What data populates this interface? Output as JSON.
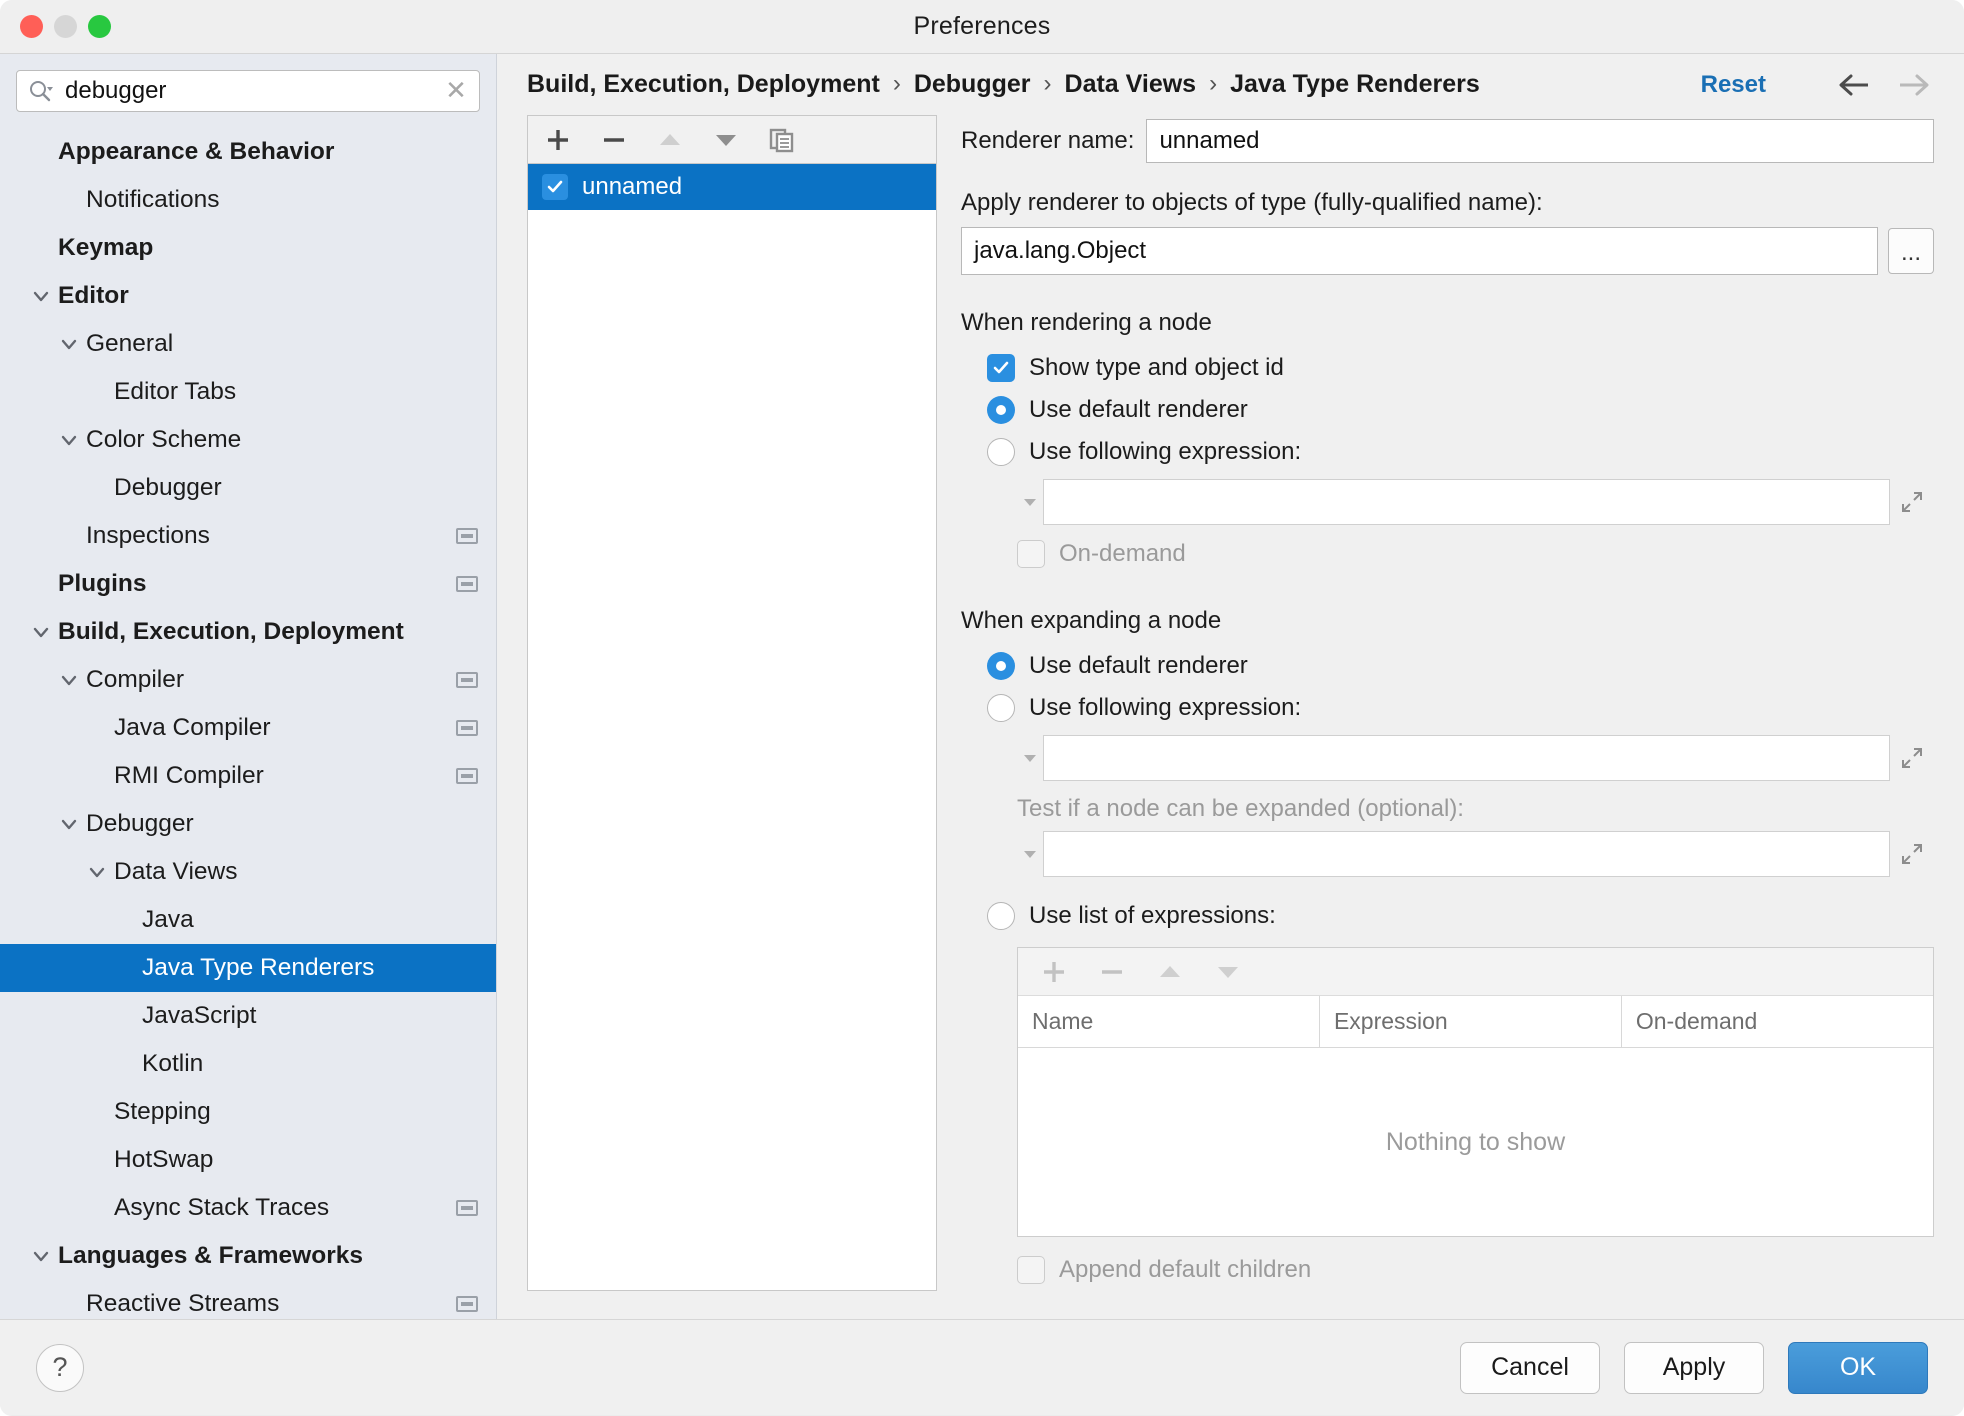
{
  "window": {
    "title": "Preferences",
    "traffic_lights": [
      "close",
      "minimize",
      "zoom"
    ]
  },
  "search": {
    "value": "debugger",
    "placeholder": "",
    "icon": "search-icon",
    "clear_icon": "close-icon"
  },
  "sidebar": {
    "items": [
      {
        "label": "Appearance & Behavior",
        "indent": 0,
        "bold": true,
        "twisty": "",
        "badge": false,
        "selected": false
      },
      {
        "label": "Notifications",
        "indent": 1,
        "bold": false,
        "twisty": "",
        "badge": false,
        "selected": false
      },
      {
        "label": "Keymap",
        "indent": 0,
        "bold": true,
        "twisty": "",
        "badge": false,
        "selected": false
      },
      {
        "label": "Editor",
        "indent": 0,
        "bold": true,
        "twisty": "down",
        "badge": false,
        "selected": false
      },
      {
        "label": "General",
        "indent": 1,
        "bold": false,
        "twisty": "down",
        "badge": false,
        "selected": false
      },
      {
        "label": "Editor Tabs",
        "indent": 2,
        "bold": false,
        "twisty": "",
        "badge": false,
        "selected": false
      },
      {
        "label": "Color Scheme",
        "indent": 1,
        "bold": false,
        "twisty": "down",
        "badge": false,
        "selected": false
      },
      {
        "label": "Debugger",
        "indent": 2,
        "bold": false,
        "twisty": "",
        "badge": false,
        "selected": false
      },
      {
        "label": "Inspections",
        "indent": 1,
        "bold": false,
        "twisty": "",
        "badge": true,
        "selected": false
      },
      {
        "label": "Plugins",
        "indent": 0,
        "bold": true,
        "twisty": "",
        "badge": true,
        "selected": false
      },
      {
        "label": "Build, Execution, Deployment",
        "indent": 0,
        "bold": true,
        "twisty": "down",
        "badge": false,
        "selected": false
      },
      {
        "label": "Compiler",
        "indent": 1,
        "bold": false,
        "twisty": "down",
        "badge": true,
        "selected": false
      },
      {
        "label": "Java Compiler",
        "indent": 2,
        "bold": false,
        "twisty": "",
        "badge": true,
        "selected": false
      },
      {
        "label": "RMI Compiler",
        "indent": 2,
        "bold": false,
        "twisty": "",
        "badge": true,
        "selected": false
      },
      {
        "label": "Debugger",
        "indent": 1,
        "bold": false,
        "twisty": "down",
        "badge": false,
        "selected": false
      },
      {
        "label": "Data Views",
        "indent": 2,
        "bold": false,
        "twisty": "down",
        "badge": false,
        "selected": false
      },
      {
        "label": "Java",
        "indent": 3,
        "bold": false,
        "twisty": "",
        "badge": false,
        "selected": false
      },
      {
        "label": "Java Type Renderers",
        "indent": 3,
        "bold": false,
        "twisty": "",
        "badge": false,
        "selected": true
      },
      {
        "label": "JavaScript",
        "indent": 3,
        "bold": false,
        "twisty": "",
        "badge": false,
        "selected": false
      },
      {
        "label": "Kotlin",
        "indent": 3,
        "bold": false,
        "twisty": "",
        "badge": false,
        "selected": false
      },
      {
        "label": "Stepping",
        "indent": 2,
        "bold": false,
        "twisty": "",
        "badge": false,
        "selected": false
      },
      {
        "label": "HotSwap",
        "indent": 2,
        "bold": false,
        "twisty": "",
        "badge": false,
        "selected": false
      },
      {
        "label": "Async Stack Traces",
        "indent": 2,
        "bold": false,
        "twisty": "",
        "badge": true,
        "selected": false
      },
      {
        "label": "Languages & Frameworks",
        "indent": 0,
        "bold": true,
        "twisty": "down",
        "badge": false,
        "selected": false
      },
      {
        "label": "Reactive Streams",
        "indent": 1,
        "bold": false,
        "twisty": "",
        "badge": true,
        "selected": false
      }
    ]
  },
  "breadcrumb": {
    "items": [
      "Build, Execution, Deployment",
      "Debugger",
      "Data Views",
      "Java Type Renderers"
    ],
    "separator": "›",
    "reset_label": "Reset",
    "back_icon": "arrow-left-icon",
    "forward_icon": "arrow-right-icon"
  },
  "renderer_list": {
    "toolbar": [
      {
        "name": "add-renderer-button",
        "icon": "plus-icon",
        "enabled": true
      },
      {
        "name": "remove-renderer-button",
        "icon": "minus-icon",
        "enabled": true
      },
      {
        "name": "move-up-button",
        "icon": "triangle-up-icon",
        "enabled": false
      },
      {
        "name": "move-down-button",
        "icon": "triangle-down-icon",
        "enabled": true
      },
      {
        "name": "copy-renderer-button",
        "icon": "copy-icon",
        "enabled": true
      }
    ],
    "items": [
      {
        "label": "unnamed",
        "checked": true,
        "selected": true
      }
    ]
  },
  "form": {
    "renderer_name_label": "Renderer name:",
    "renderer_name_value": "unnamed",
    "apply_label": "Apply renderer to objects of type (fully-qualified name):",
    "apply_value": "java.lang.Object",
    "browse_button": "...",
    "rendering": {
      "title": "When rendering a node",
      "show_type_label": "Show type and object id",
      "show_type_checked": true,
      "default_renderer_label": "Use default renderer",
      "default_renderer_selected": true,
      "expression_label": "Use following expression:",
      "expression_selected": false,
      "expression_value": "",
      "on_demand_label": "On-demand",
      "on_demand_checked": false,
      "on_demand_disabled": true
    },
    "expanding": {
      "title": "When expanding a node",
      "default_renderer_label": "Use default renderer",
      "default_renderer_selected": true,
      "expression_label": "Use following expression:",
      "expression_selected": false,
      "expression_value": "",
      "test_label": "Test if a node can be expanded (optional):",
      "test_value": "",
      "list_label": "Use list of expressions:",
      "list_selected": false,
      "table": {
        "toolbar": [
          {
            "name": "add-expression-button",
            "icon": "plus-icon",
            "enabled": false
          },
          {
            "name": "remove-expression-button",
            "icon": "minus-icon",
            "enabled": false
          },
          {
            "name": "move-expression-up-button",
            "icon": "triangle-up-icon",
            "enabled": false
          },
          {
            "name": "move-expression-down-button",
            "icon": "triangle-down-icon",
            "enabled": false
          }
        ],
        "columns": [
          "Name",
          "Expression",
          "On-demand"
        ],
        "rows": [],
        "empty_text": "Nothing to show"
      },
      "append_label": "Append default children",
      "append_checked": false,
      "append_disabled": true
    }
  },
  "footer": {
    "help_label": "?",
    "cancel_label": "Cancel",
    "apply_label": "Apply",
    "ok_label": "OK"
  },
  "colors": {
    "selection_blue": "#0b72c4",
    "accent_blue": "#2a8fe0",
    "link_blue": "#1a6fb4",
    "sidebar_bg": "#e7eaf0",
    "panel_bg": "#f0f0f0"
  }
}
